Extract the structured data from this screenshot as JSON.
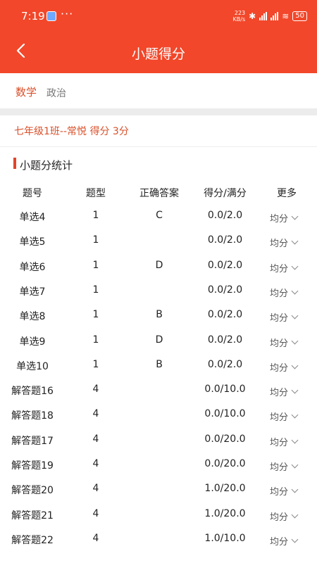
{
  "status_bar": {
    "time": "7:19",
    "dots": "···",
    "net_speed_value": "223",
    "net_speed_unit": "KB/s",
    "battery": "50"
  },
  "header": {
    "title": "小题得分",
    "back_icon": "chevron-left-icon"
  },
  "subjects": {
    "active": "数学",
    "other": "政治"
  },
  "student_line": "七年级1班--常悦 得分 3分",
  "section_title": "小题分统计",
  "columns": [
    "题号",
    "题型",
    "正确答案",
    "得分/满分",
    "更多"
  ],
  "rows": [
    {
      "name": "单选4",
      "type": "1",
      "answer": "C",
      "score": "0.0/2.0",
      "more": "均分"
    },
    {
      "name": "单选5",
      "type": "1",
      "answer": "",
      "score": "0.0/2.0",
      "more": "均分"
    },
    {
      "name": "单选6",
      "type": "1",
      "answer": "D",
      "score": "0.0/2.0",
      "more": "均分"
    },
    {
      "name": "单选7",
      "type": "1",
      "answer": "",
      "score": "0.0/2.0",
      "more": "均分"
    },
    {
      "name": "单选8",
      "type": "1",
      "answer": "B",
      "score": "0.0/2.0",
      "more": "均分"
    },
    {
      "name": "单选9",
      "type": "1",
      "answer": "D",
      "score": "0.0/2.0",
      "more": "均分"
    },
    {
      "name": "单选10",
      "type": "1",
      "answer": "B",
      "score": "0.0/2.0",
      "more": "均分"
    },
    {
      "name": "解答题16",
      "type": "4",
      "answer": "",
      "score": "0.0/10.0",
      "more": "均分"
    },
    {
      "name": "解答题18",
      "type": "4",
      "answer": "",
      "score": "0.0/10.0",
      "more": "均分"
    },
    {
      "name": "解答题17",
      "type": "4",
      "answer": "",
      "score": "0.0/20.0",
      "more": "均分"
    },
    {
      "name": "解答题19",
      "type": "4",
      "answer": "",
      "score": "0.0/20.0",
      "more": "均分"
    },
    {
      "name": "解答题20",
      "type": "4",
      "answer": "",
      "score": "1.0/20.0",
      "more": "均分"
    },
    {
      "name": "解答题21",
      "type": "4",
      "answer": "",
      "score": "1.0/20.0",
      "more": "均分"
    },
    {
      "name": "解答题22",
      "type": "4",
      "answer": "",
      "score": "1.0/10.0",
      "more": "均分"
    }
  ],
  "colors": {
    "primary": "#f2472a",
    "accent_text": "#d9502a"
  }
}
